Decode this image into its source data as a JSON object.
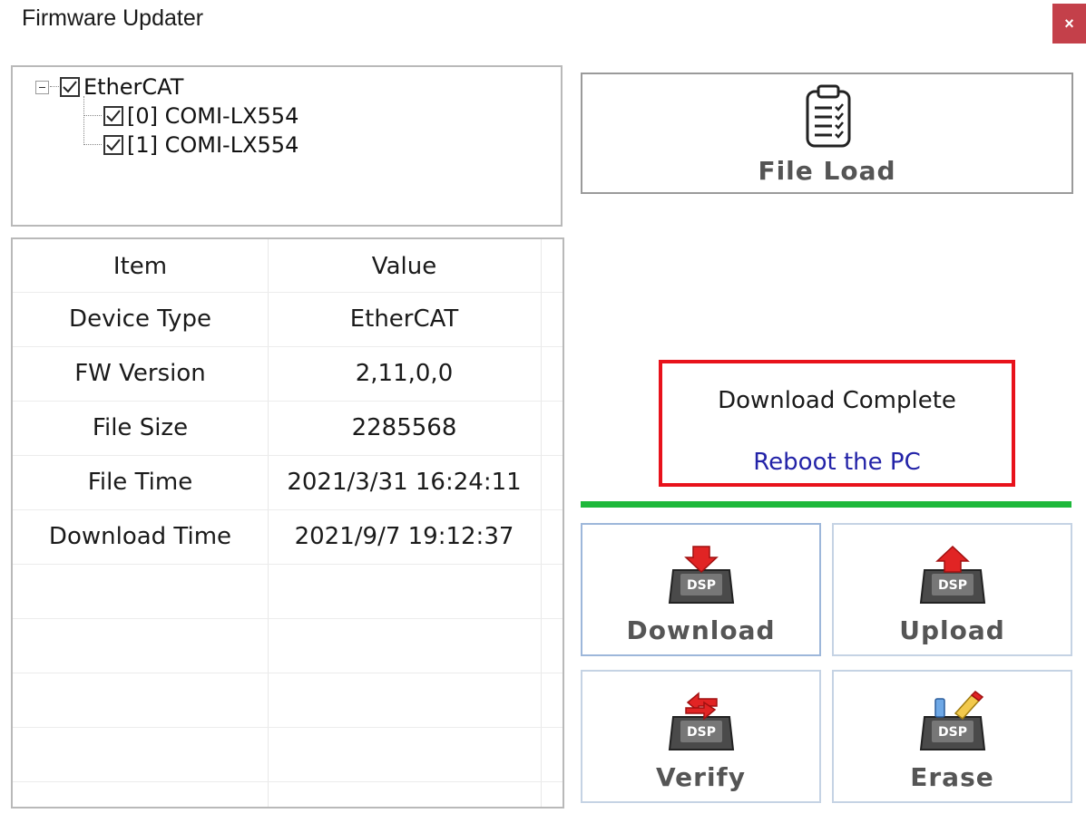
{
  "window": {
    "title": "Firmware Updater",
    "close_label": "×"
  },
  "tree": {
    "root": {
      "label": "EtherCAT",
      "checked": true,
      "expanded": true
    },
    "children": [
      {
        "label": "[0] COMI-LX554",
        "checked": true
      },
      {
        "label": "[1] COMI-LX554",
        "checked": true
      }
    ]
  },
  "info_table": {
    "headers": [
      "Item",
      "Value"
    ],
    "rows": [
      {
        "item": "Device Type",
        "value": "EtherCAT"
      },
      {
        "item": "FW Version",
        "value": "2,11,0,0"
      },
      {
        "item": "File Size",
        "value": "2285568"
      },
      {
        "item": "File Time",
        "value": "2021/3/31 16:24:11"
      },
      {
        "item": "Download Time",
        "value": "2021/9/7 19:12:37"
      }
    ]
  },
  "file_load": {
    "label": "File Load",
    "icon": "clipboard-checklist-icon"
  },
  "status": {
    "message": "Download Complete",
    "instruction": "Reboot the PC",
    "message_color": "#1a1a1a",
    "instruction_color": "#2323a8",
    "border_color": "#e8121b"
  },
  "progress": {
    "fraction": 1.0,
    "color": "#1db83a"
  },
  "actions": {
    "download": {
      "label": "Download",
      "icon": "dsp-download-icon",
      "chip": "DSP"
    },
    "upload": {
      "label": "Upload",
      "icon": "dsp-upload-icon",
      "chip": "DSP"
    },
    "verify": {
      "label": "Verify",
      "icon": "dsp-verify-icon",
      "chip": "DSP"
    },
    "erase": {
      "label": "Erase",
      "icon": "dsp-erase-icon",
      "chip": "DSP"
    }
  }
}
